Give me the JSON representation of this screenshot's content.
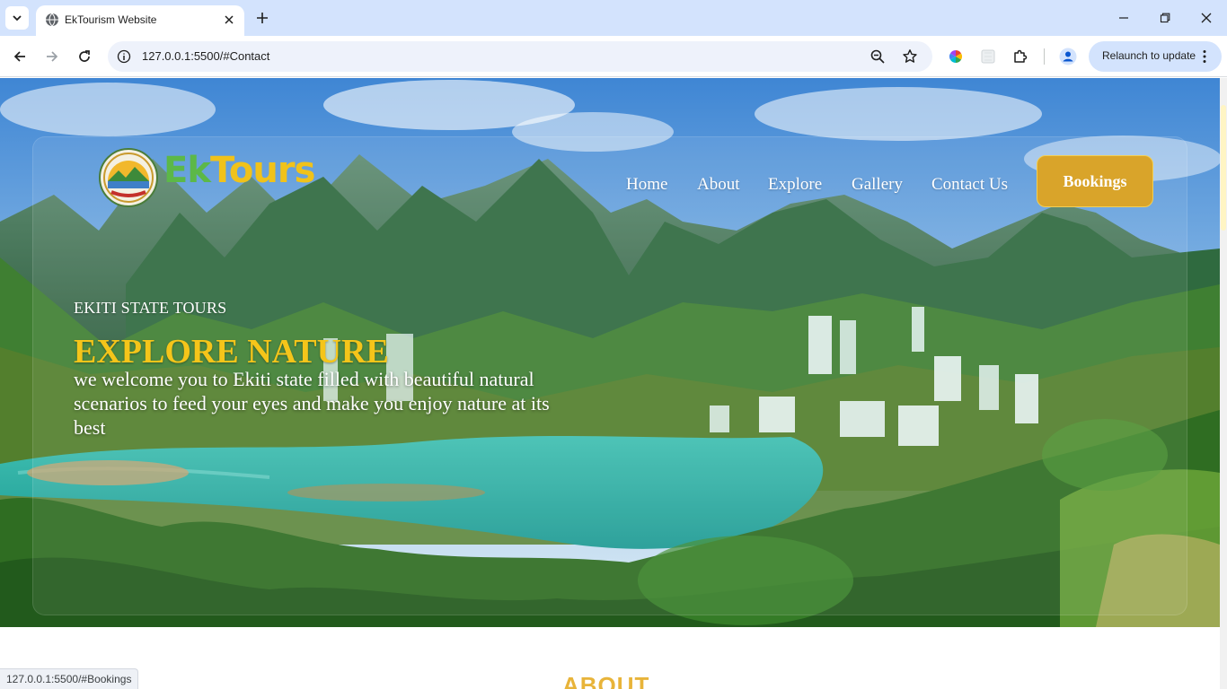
{
  "browser": {
    "tab_title": "EkTourism Website",
    "url": "127.0.0.1:5500/#Contact",
    "relaunch_label": "Relaunch to update",
    "status_url": "127.0.0.1:5500/#Bookings",
    "icons": [
      "tab-list-icon",
      "globe-icon",
      "close-icon",
      "plus-icon",
      "minimize-icon",
      "restore-icon",
      "window-close-icon",
      "back-icon",
      "forward-icon",
      "reload-icon",
      "info-icon",
      "zoom-icon",
      "star-icon",
      "color-wheel-icon",
      "extension-placeholder-icon",
      "puzzle-icon",
      "profile-icon",
      "kebab-icon"
    ]
  },
  "site": {
    "brand_ek": "Ek",
    "brand_tours": "Tours",
    "nav": [
      "Home",
      "About",
      "Explore",
      "Gallery",
      "Contact Us"
    ],
    "bookings_label": "Bookings",
    "hero": {
      "kicker": "EKITI STATE TOURS",
      "headline": "EXPLORE NATURE",
      "lede": "we welcome you to Ekiti state filled with beautiful natural scenarios to feed your eyes and make you enjoy nature at its best"
    },
    "about_title": "ABOUT",
    "colors": {
      "brand_green": "#5cb848",
      "brand_gold": "#f0c21a",
      "headline_gold": "#f5c51a",
      "button_gold": "#d9a42a",
      "chrome_blue": "#d3e3fd"
    }
  }
}
